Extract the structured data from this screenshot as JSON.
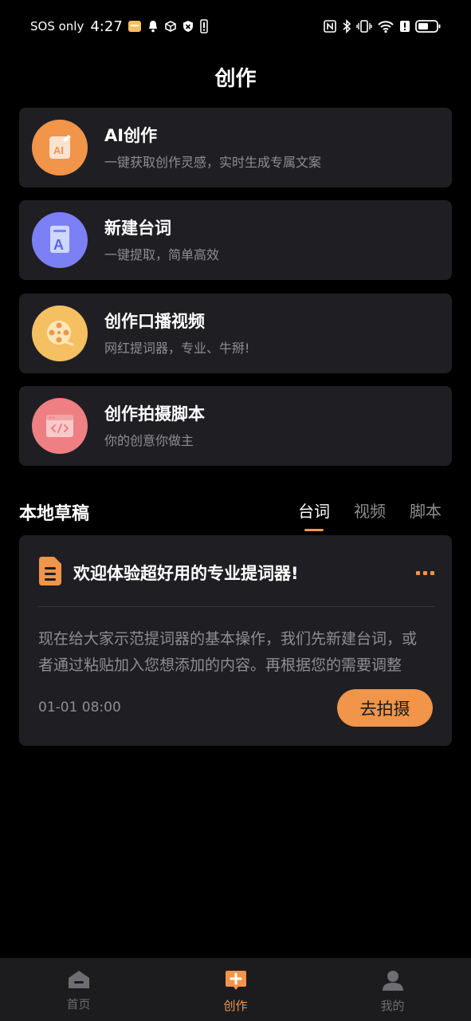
{
  "status_bar": {
    "carrier": "SOS only",
    "time": "4:27",
    "icons": [
      "app-notification-icon",
      "bell-icon",
      "box-icon",
      "vpn-icon",
      "sim-icon",
      "nfc-icon",
      "bluetooth-icon",
      "vibrate-icon",
      "wifi-icon",
      "alert-icon",
      "battery-icon"
    ]
  },
  "header": {
    "title": "创作"
  },
  "features": [
    {
      "title": "AI创作",
      "subtitle": "一键获取创作灵感，实时生成专属文案",
      "icon": "ai-write-icon",
      "color": "#f0954a"
    },
    {
      "title": "新建台词",
      "subtitle": "一键提取，简单高效",
      "icon": "document-a-icon",
      "color": "#7c80f5"
    },
    {
      "title": "创作口播视频",
      "subtitle": "网红提词器，专业、牛掰!",
      "icon": "film-reel-icon",
      "color": "#f4c062"
    },
    {
      "title": "创作拍摄脚本",
      "subtitle": "你的创意你做主",
      "icon": "code-window-icon",
      "color": "#ee7f82"
    }
  ],
  "drafts": {
    "title": "本地草稿",
    "tabs": [
      "台词",
      "视频",
      "脚本"
    ],
    "active_tab": "台词",
    "items": [
      {
        "title": "欢迎体验超好用的专业提词器!",
        "body": "现在给大家示范提词器的基本操作，我们先新建台词，或者通过粘贴加入您想添加的内容。再根据您的需要调整",
        "date": "01-01 08:00",
        "action": "去拍摄"
      }
    ]
  },
  "bottom_nav": {
    "items": [
      {
        "label": "首页",
        "icon": "home-icon"
      },
      {
        "label": "创作",
        "icon": "create-plus-icon"
      },
      {
        "label": "我的",
        "icon": "profile-icon"
      }
    ],
    "active": "创作"
  },
  "colors": {
    "accent": "#f0954a",
    "card_bg": "#1f1f23",
    "muted_text": "#8d8d92"
  }
}
